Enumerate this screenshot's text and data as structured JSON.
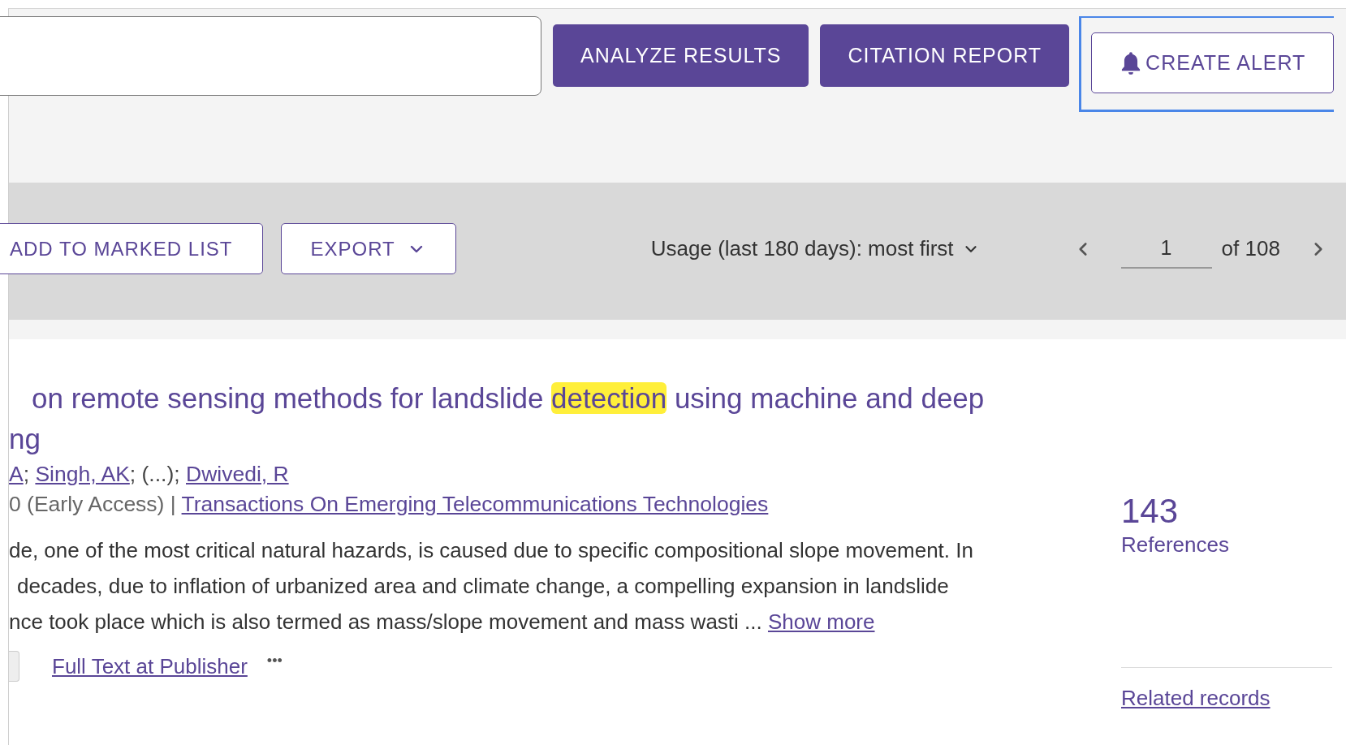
{
  "actions": [
    {
      "label": "ANALYZE RESULTS",
      "kind": "filled"
    },
    {
      "label": "CITATION REPORT",
      "kind": "filled"
    },
    {
      "label": "CREATE ALERT",
      "kind": "outlined",
      "focused": true
    }
  ],
  "toolbar": {
    "add_to_marked_list": "ADD TO MARKED LIST",
    "export": "EXPORT",
    "sort": "Usage (last 180 days): most first",
    "page": "1",
    "of_label": "of",
    "total_pages": "108"
  },
  "result": {
    "title_lines": [
      [
        {
          "text": "on remote sensing methods for landslide ",
          "highlighted": false
        },
        {
          "text": "detection",
          "highlighted": true
        },
        {
          "text": " using machine and deep",
          "highlighted": false
        }
      ],
      [
        {
          "text": "ng",
          "highlighted": false
        }
      ]
    ],
    "authors": [
      {
        "text": "A",
        "link": true
      },
      {
        "text": "; ",
        "link": false
      },
      {
        "text": "Singh, AK",
        "link": true
      },
      {
        "text": "; (...); ",
        "link": false
      },
      {
        "text": "Dwivedi, R",
        "link": true
      }
    ],
    "source_prefix": "0 (Early Access) | ",
    "journal": "Transactions On Emerging Telecommunications Technologies",
    "abstract_lines": [
      "de, one of the most critical natural hazards, is caused due to specific compositional slope movement. In",
      "decades, due to inflation of urbanized area and climate change, a compelling expansion in landslide",
      "nce took place which is also termed as mass/slope movement and mass wasti ..."
    ],
    "show_more": "Show more",
    "full_text": "Full Text at Publisher",
    "more": "•••",
    "references_count": "143",
    "references_label": "References",
    "related": "Related records"
  }
}
